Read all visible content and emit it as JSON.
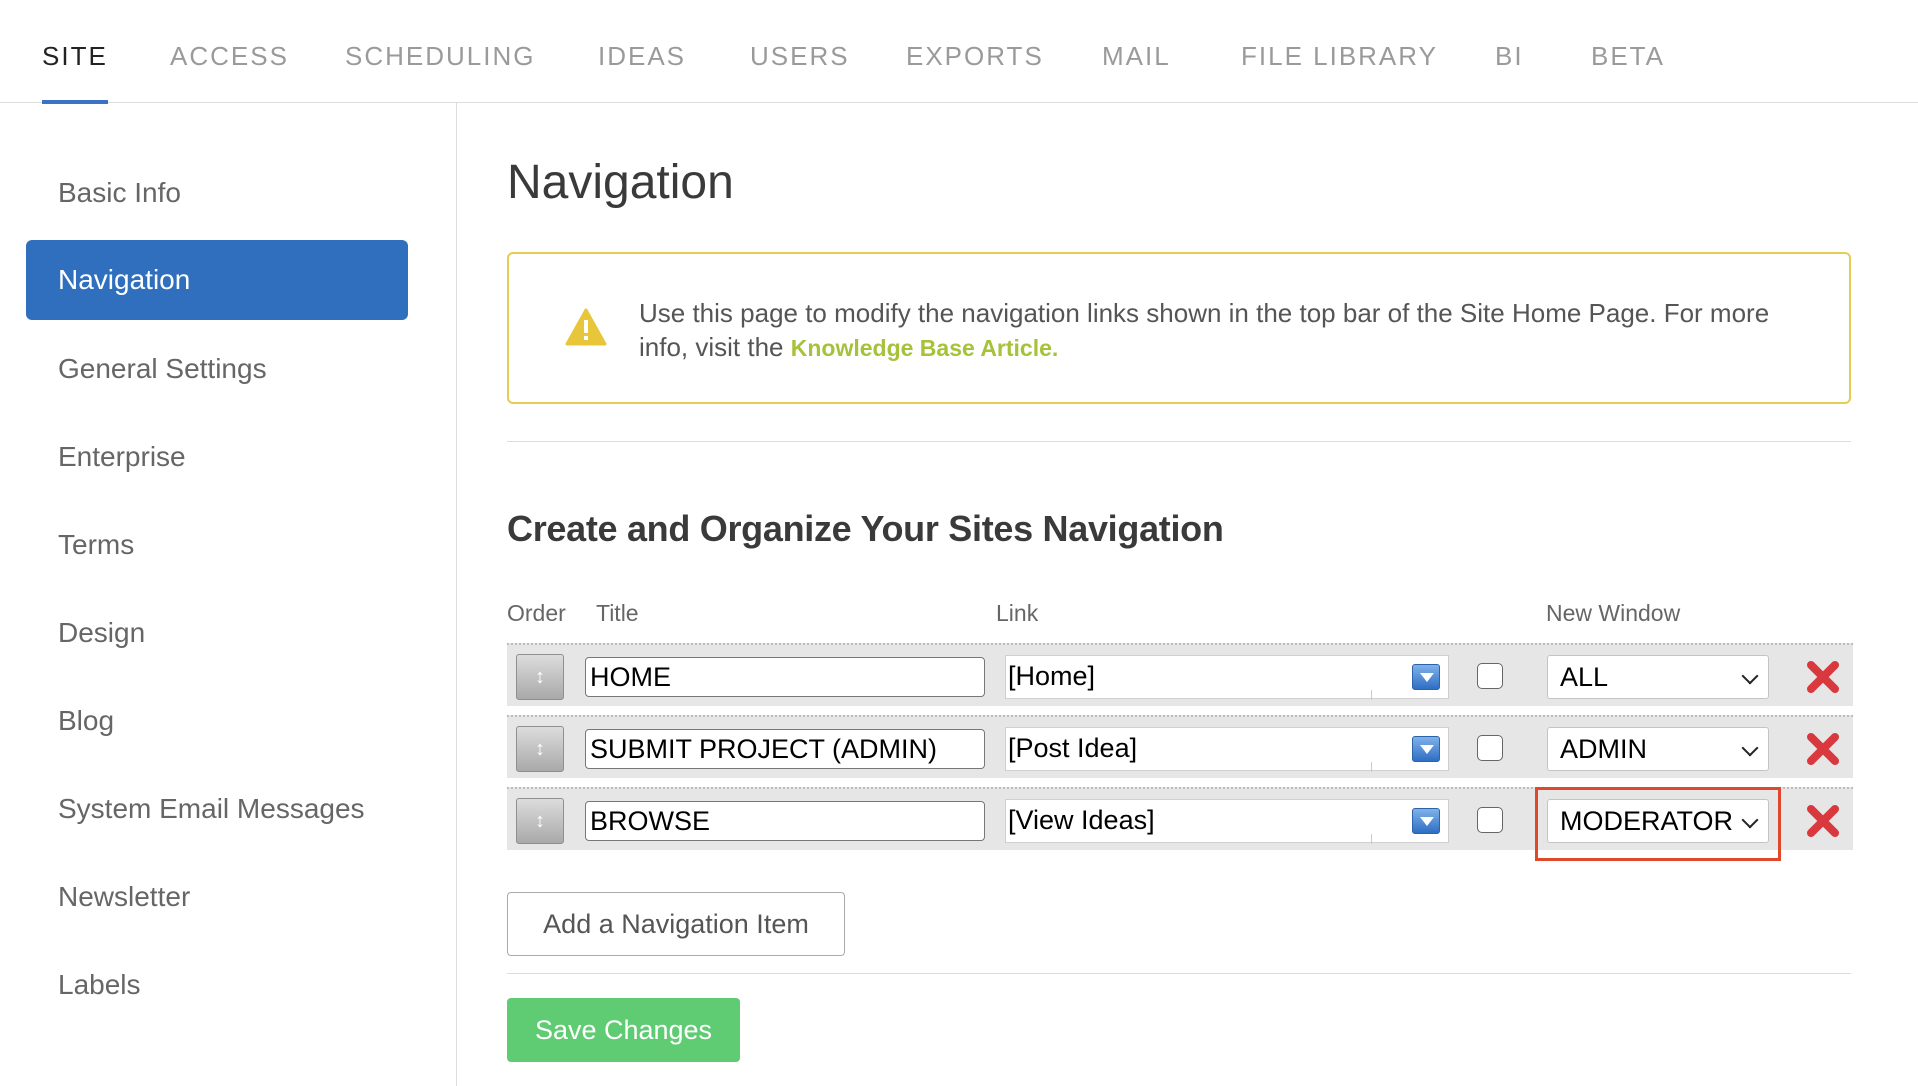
{
  "top_tabs": [
    "SITE",
    "ACCESS",
    "SCHEDULING",
    "IDEAS",
    "USERS",
    "EXPORTS",
    "MAIL",
    "FILE LIBRARY",
    "BI",
    "BETA"
  ],
  "active_tab": "SITE",
  "sidebar": {
    "items": [
      "Basic Info",
      "Navigation",
      "General Settings",
      "Enterprise",
      "Terms",
      "Design",
      "Blog",
      "System Email Messages",
      "Newsletter",
      "Labels"
    ],
    "active": "Navigation"
  },
  "main": {
    "title": "Navigation",
    "notice": {
      "text": "Use this page to modify the navigation links shown in the top bar of the Site Home Page. For more info, visit the ",
      "link_text": "Knowledge Base Article.",
      "icon": "warning-icon",
      "border_color": "#e6cc55"
    },
    "section_title": "Create and Organize Your Sites Navigation",
    "columns": {
      "order": "Order",
      "title": "Title",
      "link": "Link",
      "new_window": "New Window"
    },
    "rows": [
      {
        "title": "HOME",
        "link": "[Home]",
        "new_window": false,
        "access": "ALL"
      },
      {
        "title": "SUBMIT PROJECT (ADMIN)",
        "link": "[Post Idea]",
        "new_window": false,
        "access": "ADMIN"
      },
      {
        "title": "BROWSE",
        "link": "[View Ideas]",
        "new_window": false,
        "access": "MODERATOR"
      }
    ],
    "add_button": "Add a Navigation Item",
    "save_button": "Save Changes"
  },
  "colors": {
    "accent": "#2f6fbd",
    "save": "#5fcb72",
    "delete": "#d9383f",
    "highlight": "#e0482b",
    "link": "#a5c23a"
  }
}
